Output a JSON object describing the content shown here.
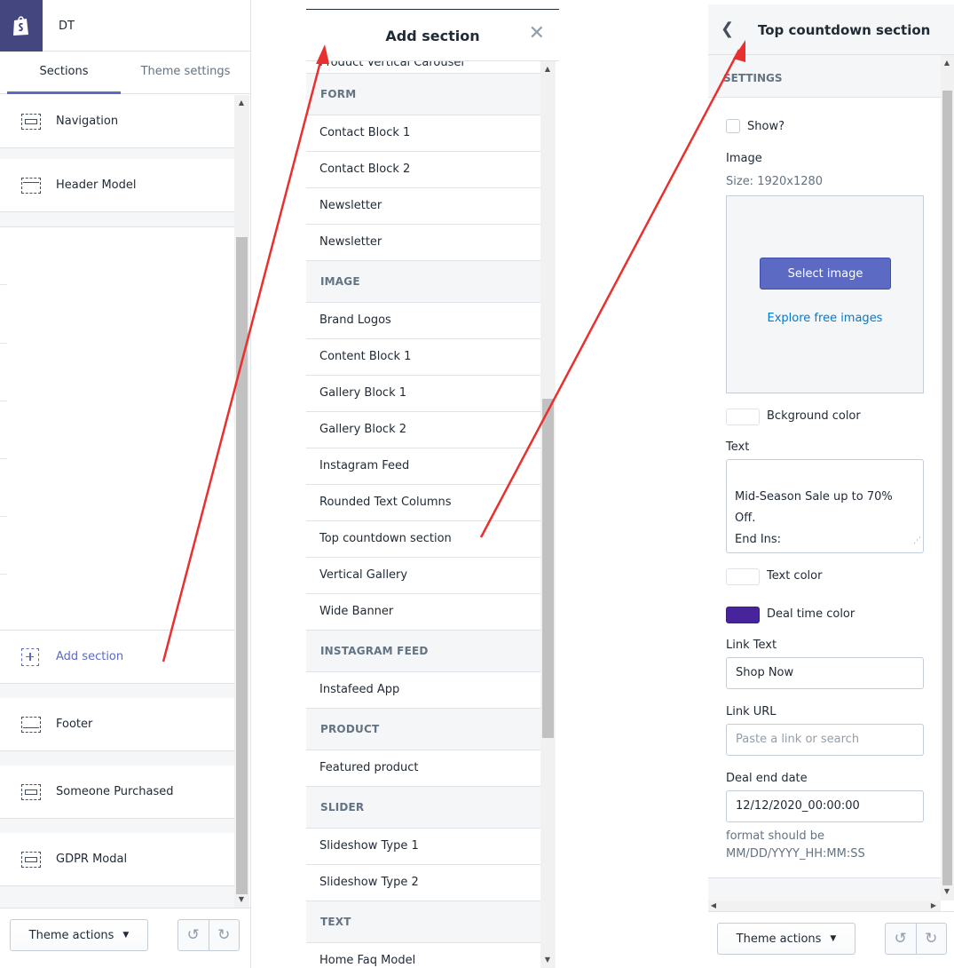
{
  "colors": {
    "accent": "#5c6ac4",
    "shopify_brand": "#43467f",
    "deal_time": "#47249b",
    "link": "#007ace",
    "arrow": "#e8312f"
  },
  "panel1": {
    "store_name": "DT",
    "tabs": [
      "Sections",
      "Theme settings"
    ],
    "sections": [
      {
        "label": "Navigation",
        "icon": "section-icon"
      },
      {
        "label": "Header Model",
        "icon": "header-section-icon"
      },
      {
        "label": "Add section",
        "icon": "add-section-icon"
      },
      {
        "label": "Footer",
        "icon": "footer-section-icon"
      },
      {
        "label": "Someone Purchased",
        "icon": "section-icon"
      },
      {
        "label": "GDPR Modal",
        "icon": "section-icon"
      }
    ],
    "theme_actions": "Theme actions",
    "undo_icon": "undo-icon",
    "redo_icon": "redo-icon"
  },
  "panel2": {
    "title": "Add section",
    "cut_item": "Product Vertical Carousel",
    "groups": [
      {
        "category": "FORM",
        "items": [
          "Contact Block 1",
          "Contact Block 2",
          "Newsletter",
          "Newsletter"
        ]
      },
      {
        "category": "IMAGE",
        "items": [
          "Brand Logos",
          "Content Block 1",
          "Gallery Block 1",
          "Gallery Block 2",
          "Instagram Feed",
          "Rounded Text Columns",
          "Top countdown section",
          "Vertical Gallery",
          "Wide Banner"
        ]
      },
      {
        "category": "INSTAGRAM FEED",
        "items": [
          "Instafeed App"
        ]
      },
      {
        "category": "PRODUCT",
        "items": [
          "Featured product"
        ]
      },
      {
        "category": "SLIDER",
        "items": [
          "Slideshow Type 1",
          "Slideshow Type 2"
        ]
      },
      {
        "category": "TEXT",
        "items": [
          "Home Faq Model"
        ]
      }
    ]
  },
  "panel3": {
    "title": "Top countdown section",
    "settings_heading": "SETTINGS",
    "show_label": "Show?",
    "show_checked": false,
    "image_label": "Image",
    "image_size": "Size: 1920x1280",
    "select_image": "Select image",
    "explore_images": "Explore free images",
    "bg_color_label": "Bckground color",
    "bg_color": "#ffffff",
    "text_label": "Text",
    "text_value": "Mid-Season Sale up to 70% Off.\nEnd Ins:",
    "text_color_label": "Text color",
    "text_color": "#ffffff",
    "deal_color_label": "Deal time color",
    "deal_color": "#47249b",
    "link_text_label": "Link Text",
    "link_text_value": "Shop Now",
    "link_url_label": "Link URL",
    "link_url_placeholder": "Paste a link or search",
    "deal_end_label": "Deal end date",
    "deal_end_value": "12/12/2020_00:00:00",
    "deal_help": "format should be MM/DD/YYYY_HH:MM:SS",
    "theme_actions": "Theme actions"
  }
}
